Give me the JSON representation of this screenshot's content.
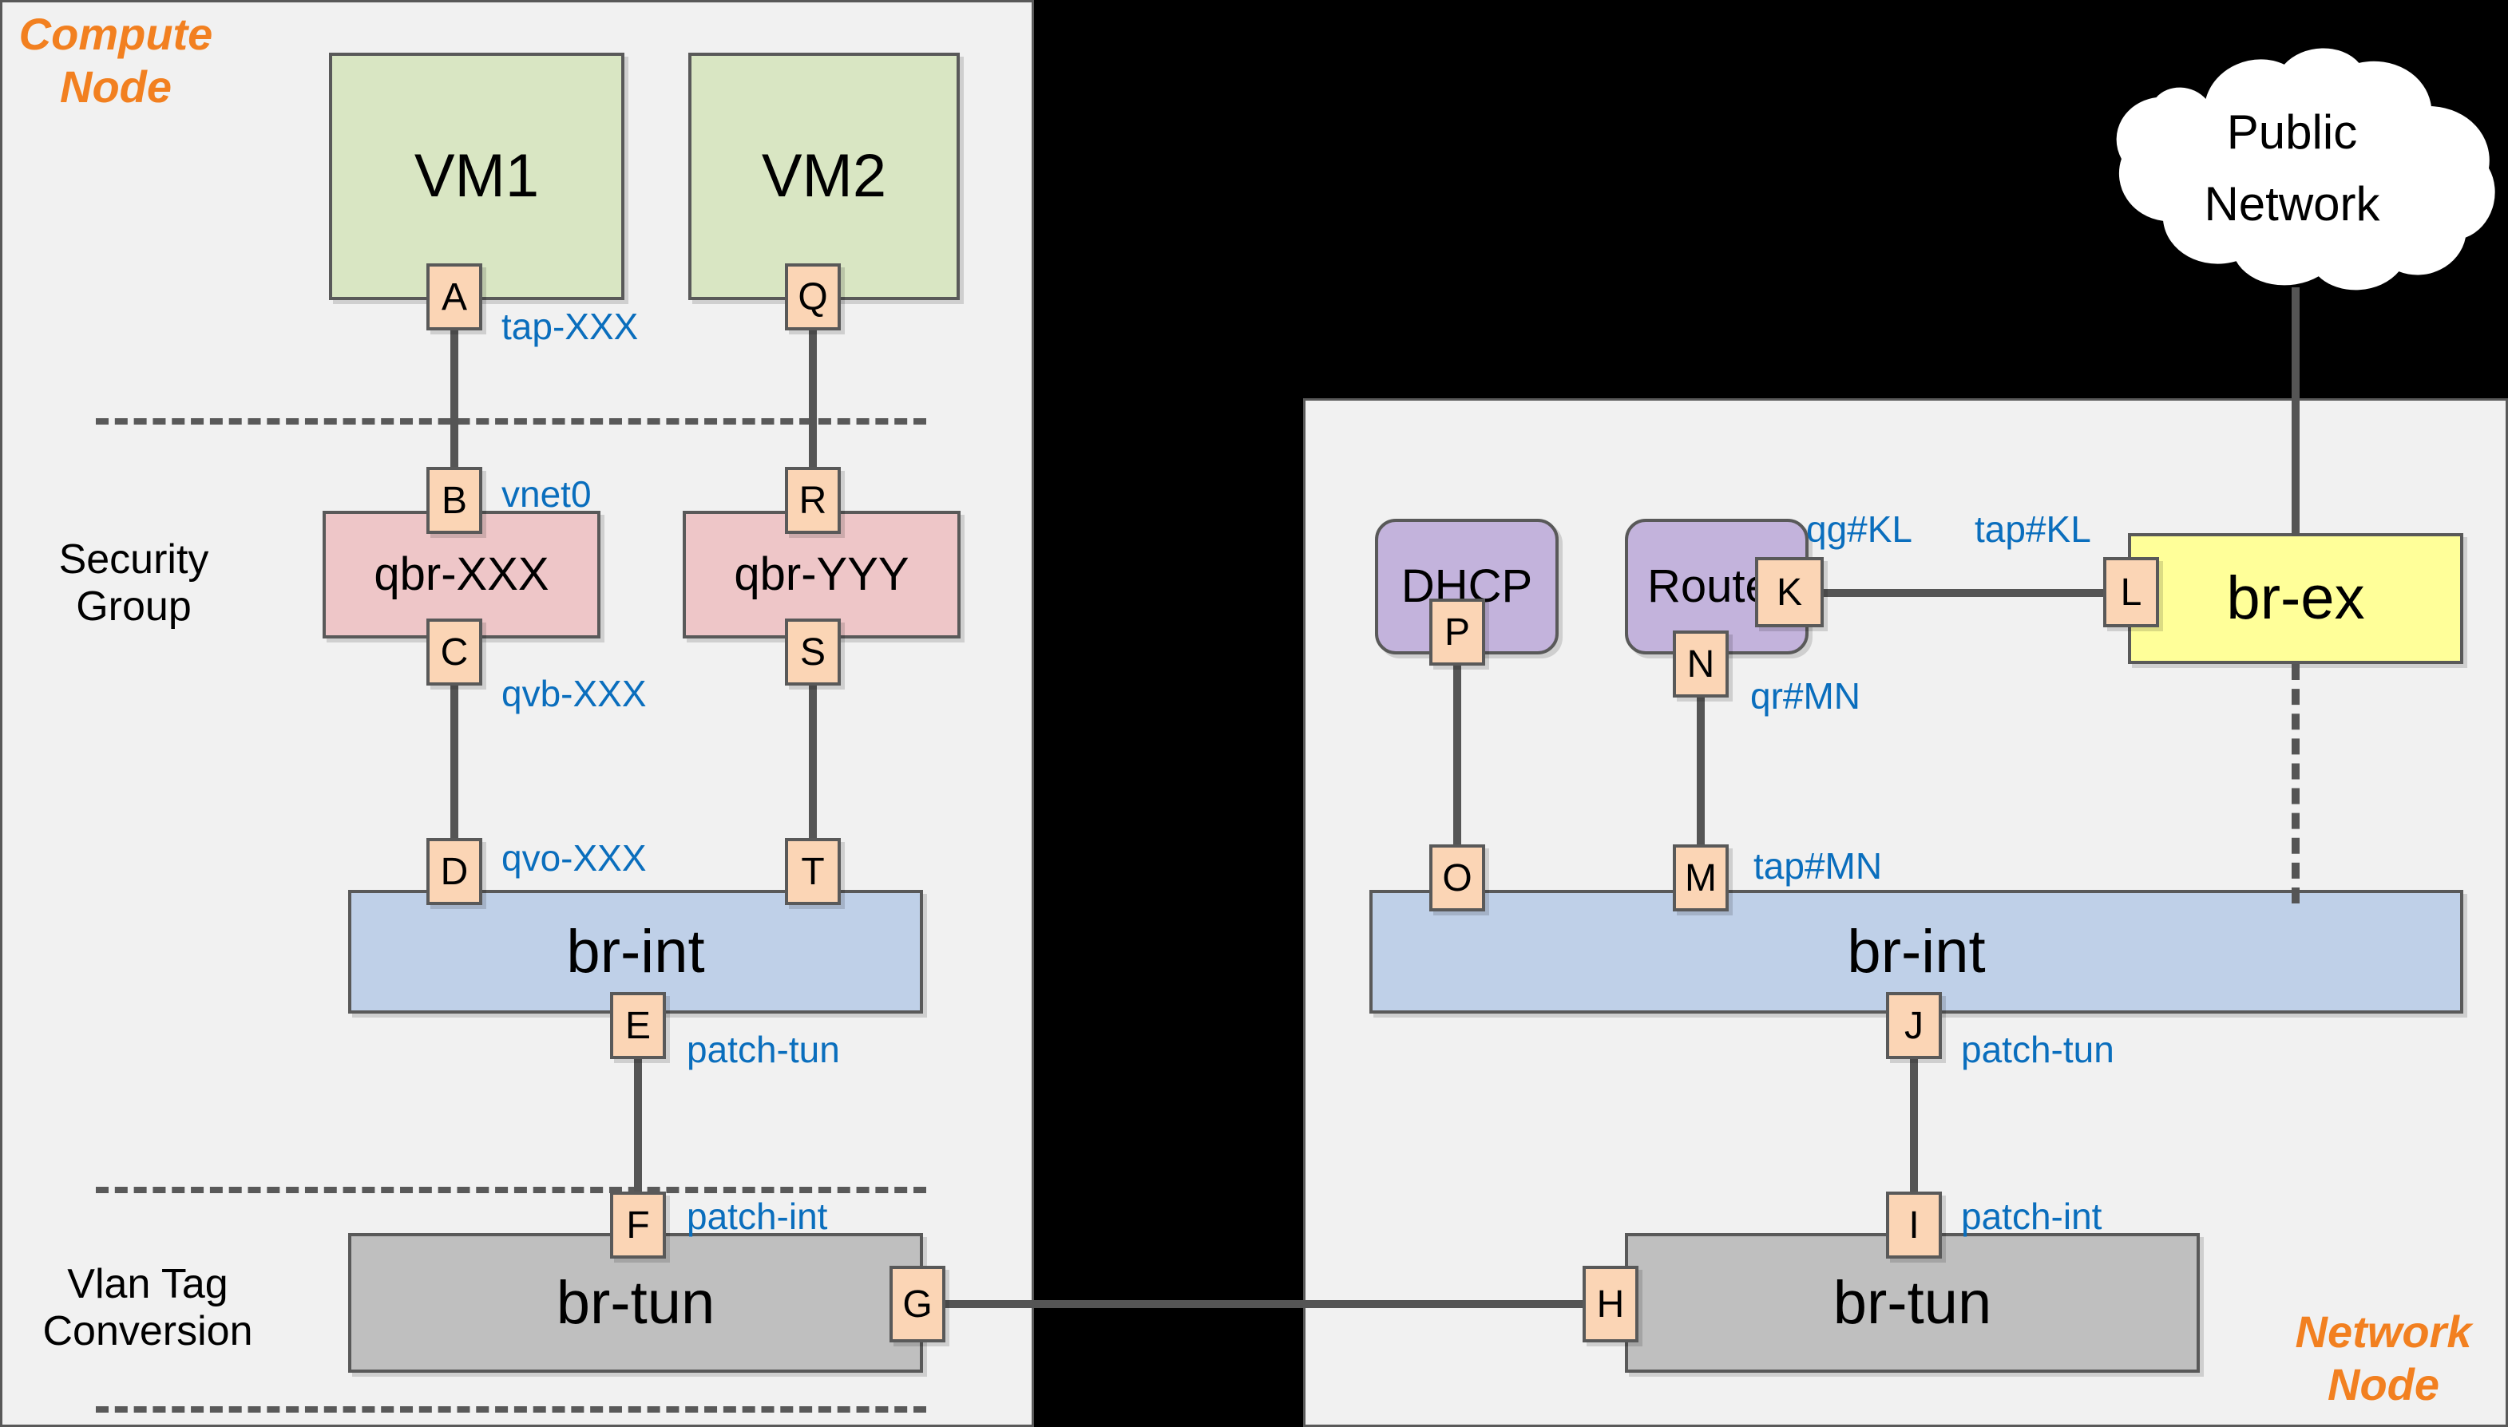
{
  "nodes": {
    "compute": {
      "title": "Compute\nNode"
    },
    "network": {
      "title": "Network\nNode"
    }
  },
  "zones": {
    "security_group": "Security\nGroup",
    "vlan_tag_conversion": "Vlan Tag\nConversion"
  },
  "cloud": {
    "label": "Public\nNetwork"
  },
  "boxes": {
    "vm1": "VM1",
    "vm2": "VM2",
    "qbr_xxx": "qbr-XXX",
    "qbr_yyy": "qbr-YYY",
    "br_int_compute": "br-int",
    "br_tun_compute": "br-tun",
    "br_int_network": "br-int",
    "br_tun_network": "br-tun",
    "br_ex": "br-ex",
    "dhcp": "DHCP",
    "router": "Router"
  },
  "ports": {
    "a": "A",
    "b": "B",
    "c": "C",
    "d": "D",
    "e": "E",
    "f": "F",
    "g": "G",
    "h": "H",
    "i": "I",
    "j": "J",
    "k": "K",
    "l": "L",
    "m": "M",
    "n": "N",
    "o": "O",
    "p": "P",
    "q": "Q",
    "r": "R",
    "s": "S",
    "t": "T"
  },
  "interfaces": {
    "tap_xxx": "tap-XXX",
    "vnet0": "vnet0",
    "qvb_xxx": "qvb-XXX",
    "qvo_xxx": "qvo-XXX",
    "patch_tun_compute": "patch-tun",
    "patch_int_compute": "patch-int",
    "patch_tun_network": "patch-tun",
    "patch_int_network": "patch-int",
    "qg_kl": "qg#KL",
    "tap_kl": "tap#KL",
    "qr_mn": "qr#MN",
    "tap_mn": "tap#MN"
  },
  "colors": {
    "accent_orange": "#f28020",
    "interface_blue": "#0a6ebd",
    "vm_green": "#d9e6c3",
    "qbr_pink": "#eec6c8",
    "brint_blue": "#bfd0e8",
    "brtun_gray": "#bfbfbf",
    "brex_yellow": "#ffff99",
    "service_purple": "#c3b3dc",
    "port_peach": "#fbd5b5",
    "panel_gray": "#f1f1f1",
    "line_gray": "#555555",
    "background": "#000000"
  }
}
